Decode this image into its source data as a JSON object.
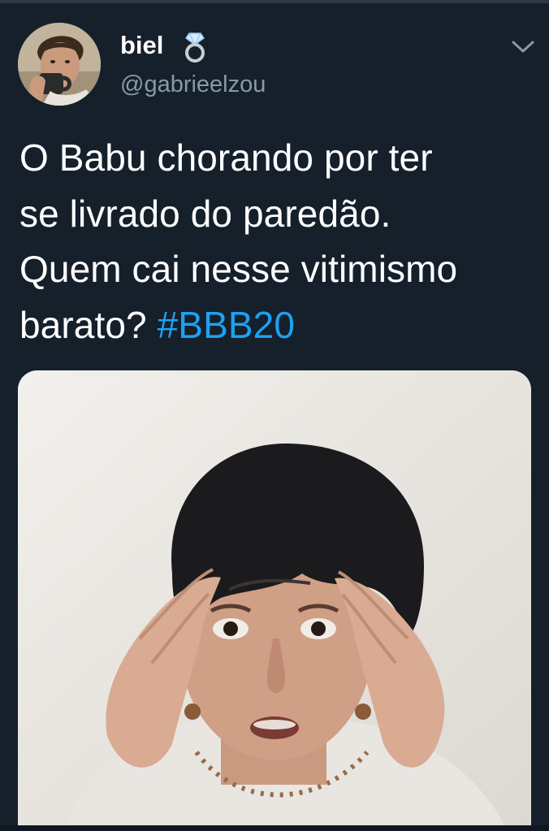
{
  "tweet": {
    "display_name": "biel",
    "handle": "@gabrieelzou",
    "text_lines": [
      "O Babu chorando por ter",
      "se livrado do paredão.",
      "Quem cai nesse vitimismo",
      "barato? "
    ],
    "hashtag": "#BBB20"
  },
  "icons": {
    "name_badge": "ring-icon",
    "menu": "chevron-down-icon"
  },
  "colors": {
    "background": "#15202b",
    "text": "#ffffff",
    "secondary_text": "#8899a6",
    "link": "#1da1f2"
  }
}
